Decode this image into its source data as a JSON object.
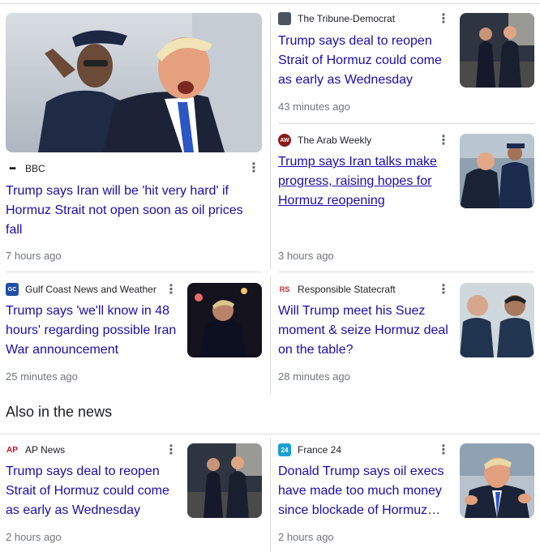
{
  "section_title": "Also in the news",
  "colors": {
    "link": "#1a0dab",
    "meta": "#70757a",
    "divider": "#dadce0"
  },
  "cards": {
    "bbc": {
      "source": "BBC",
      "favicon_text": "•••",
      "headline": "Trump says Iran will be 'hit very hard' if Hormuz Strait not open soon as oil prices fall",
      "time": "7 hours ago",
      "menu_icon": "⋮"
    },
    "tribune": {
      "source": "The Tribune-Democrat",
      "favicon_text": "",
      "headline": "Trump says deal to reopen Strait of Hormuz could come as early as Wednesday",
      "time": "43 minutes ago",
      "menu_icon": "⋮"
    },
    "arab_weekly": {
      "source": "The Arab Weekly",
      "favicon_text": "AW",
      "headline": "Trump says Iran talks make progress, raising hopes for Hormuz reopening",
      "time": "3 hours ago",
      "menu_icon": "⋮"
    },
    "gulf_coast": {
      "source": "Gulf Coast News and Weather",
      "favicon_text": "GC",
      "headline": "Trump says 'we'll know in 48 hours' regarding possible Iran War announcement",
      "time": "25 minutes ago",
      "menu_icon": "⋮"
    },
    "responsible": {
      "source": "Responsible Statecraft",
      "favicon_text": "RS",
      "headline": "Will Trump meet his Suez moment & seize Hormuz deal on the table?",
      "time": "28 minutes ago",
      "menu_icon": "⋮"
    },
    "ap": {
      "source": "AP News",
      "favicon_text": "AP",
      "headline": "Trump says deal to reopen Strait of Hormuz could come as early as Wednesday",
      "time": "2 hours ago",
      "menu_icon": "⋮"
    },
    "france24": {
      "source": "France 24",
      "favicon_text": "24",
      "headline": "Donald Trump says oil execs have made too much money since blockade of Hormuz…",
      "time": "2 hours ago",
      "menu_icon": "⋮"
    }
  }
}
